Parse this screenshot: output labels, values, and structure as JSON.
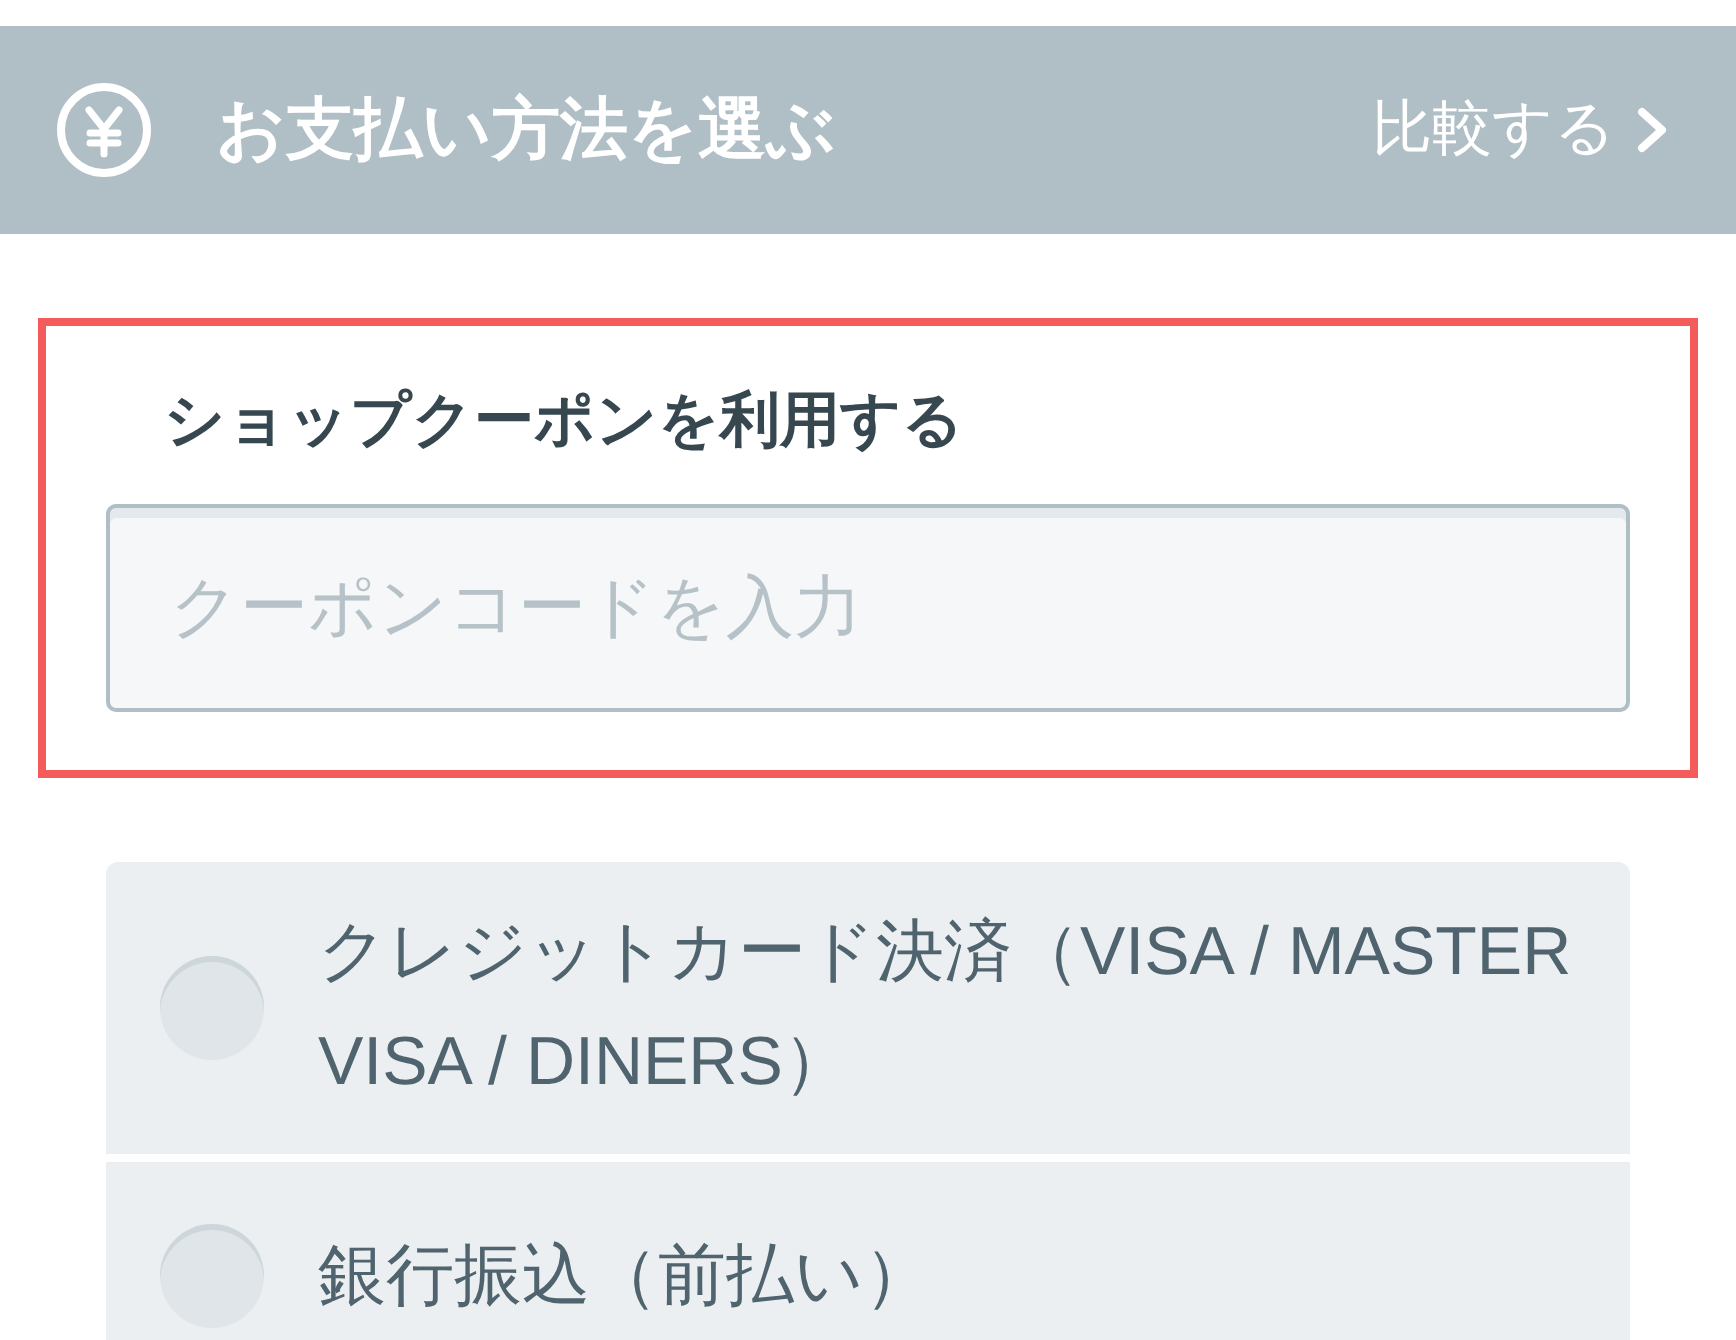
{
  "header": {
    "title": "お支払い方法を選ぶ",
    "compare_link": "比較する"
  },
  "coupon": {
    "highlighted": true,
    "label": "ショップクーポンを利用する",
    "placeholder": "クーポンコードを入力"
  },
  "payment_methods": [
    {
      "label": "クレジットカード決済（VISA / MASTER VISA / DINERS）",
      "selected": false
    },
    {
      "label": "銀行振込（前払い）",
      "selected": false
    }
  ]
}
